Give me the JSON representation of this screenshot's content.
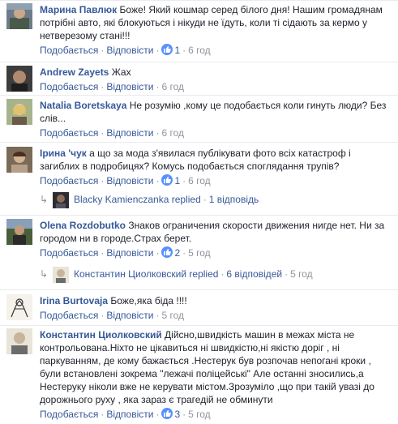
{
  "actions": {
    "like": "Подобається",
    "reply": "Відповісти"
  },
  "comments": [
    {
      "author": "Марина Павлюк",
      "text": "Боже! Який кошмар серед білого дня! Нашим громадянам потрібні авто, які блокуються і нікуди не їдуть, коли ті сідають за кермо у нетверезому стані!!!",
      "likes": "1",
      "time": "6 год"
    },
    {
      "author": "Andrew Zayets",
      "text": "Жах",
      "likes": "",
      "time": "6 год"
    },
    {
      "author": "Natalia Boretskaya",
      "text": "Не розумію ,кому це подобається коли гинуть люди? Без слів...",
      "likes": "",
      "time": "6 год"
    },
    {
      "author": "Ірина 'чук",
      "text": "а що за мода з'явилася публікувати фото всіх катастроф і загиблих в подробицях? Комусь подобається споглядання трупів?",
      "likes": "1",
      "time": "6 год",
      "reply": {
        "name": "Blacky Kamienczanka replied",
        "count": "1 відповідь",
        "time": ""
      }
    },
    {
      "author": "Olena Rozdobutko",
      "text": "Знаков ограничения скорости движения нигде нет. Ни за городом ни в городе.Страх берет.",
      "likes": "2",
      "time": "5 год",
      "reply": {
        "name": "Константин Циолковский replied",
        "count": "6 відповідей",
        "time": "5 год"
      }
    },
    {
      "author": "Irina Burtovaja",
      "text": "Боже,яка біда !!!!",
      "likes": "",
      "time": "5 год"
    },
    {
      "author": "Константин Циолковский",
      "text": "Дійсно,швидкість машин в межах міста не контрольована.Ніхто не цікавиться ні швидкістю,ні якістю доріг , ні паркуванням, де кому бажається .Нестерук був розпочав непогані кроки , були встановлені зокрема \"лежачі поліцейські\" Але останні зносились,а Нестеруку ніколи вже не керувати містом.Зрозуміло ,що при такій увазі до дорожнього руху , яка зараз є трагедій не обминути",
      "likes": "3",
      "time": "5 год"
    }
  ],
  "colors": {
    "link": "#365899",
    "meta": "#90949c",
    "like_badge": "#5890ff",
    "divider": "#e9ebee"
  }
}
